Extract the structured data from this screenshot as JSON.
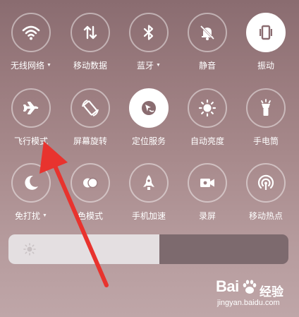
{
  "colors": {
    "tile_active": "#ffffff",
    "icon_light": "#ffffff",
    "icon_on_active": "#8a6c70",
    "arrow": "#e8332e"
  },
  "brightness": {
    "level": 0.54,
    "icon": "sun-icon"
  },
  "tiles": [
    {
      "id": "wifi",
      "label": "无线网络",
      "icon": "wifi-icon",
      "active": false,
      "has_menu": true
    },
    {
      "id": "data",
      "label": "移动数据",
      "icon": "mobile-data-icon",
      "active": false,
      "has_menu": false
    },
    {
      "id": "bluetooth",
      "label": "蓝牙",
      "icon": "bluetooth-icon",
      "active": false,
      "has_menu": true
    },
    {
      "id": "mute",
      "label": "静音",
      "icon": "bell-off-icon",
      "active": false,
      "has_menu": false
    },
    {
      "id": "vibrate",
      "label": "振动",
      "icon": "vibrate-icon",
      "active": true,
      "has_menu": false
    },
    {
      "id": "airplane",
      "label": "飞行模式",
      "icon": "airplane-icon",
      "active": false,
      "has_menu": false
    },
    {
      "id": "rotation",
      "label": "屏幕旋转",
      "icon": "screen-rotation-icon",
      "active": false,
      "has_menu": false
    },
    {
      "id": "location",
      "label": "定位服务",
      "icon": "location-icon",
      "active": true,
      "has_menu": false
    },
    {
      "id": "auto_brightness",
      "label": "自动亮度",
      "icon": "brightness-icon",
      "active": false,
      "has_menu": false
    },
    {
      "id": "flashlight",
      "label": "手电筒",
      "icon": "flashlight-icon",
      "active": false,
      "has_menu": false
    },
    {
      "id": "dnd",
      "label": "免打扰",
      "icon": "moon-icon",
      "active": false,
      "has_menu": true
    },
    {
      "id": "color_mode",
      "label": "色模式",
      "icon": "color-mode-icon",
      "active": false,
      "has_menu": false
    },
    {
      "id": "boost",
      "label": "手机加速",
      "icon": "rocket-icon",
      "active": false,
      "has_menu": false
    },
    {
      "id": "screen_record",
      "label": "录屏",
      "icon": "video-camera-icon",
      "active": false,
      "has_menu": false
    },
    {
      "id": "hotspot",
      "label": "移动热点",
      "icon": "hotspot-icon",
      "active": false,
      "has_menu": false
    }
  ],
  "watermark": {
    "logo_text": "Bai",
    "brand_cn": "经验",
    "url": "jingyan.baidu.com"
  }
}
